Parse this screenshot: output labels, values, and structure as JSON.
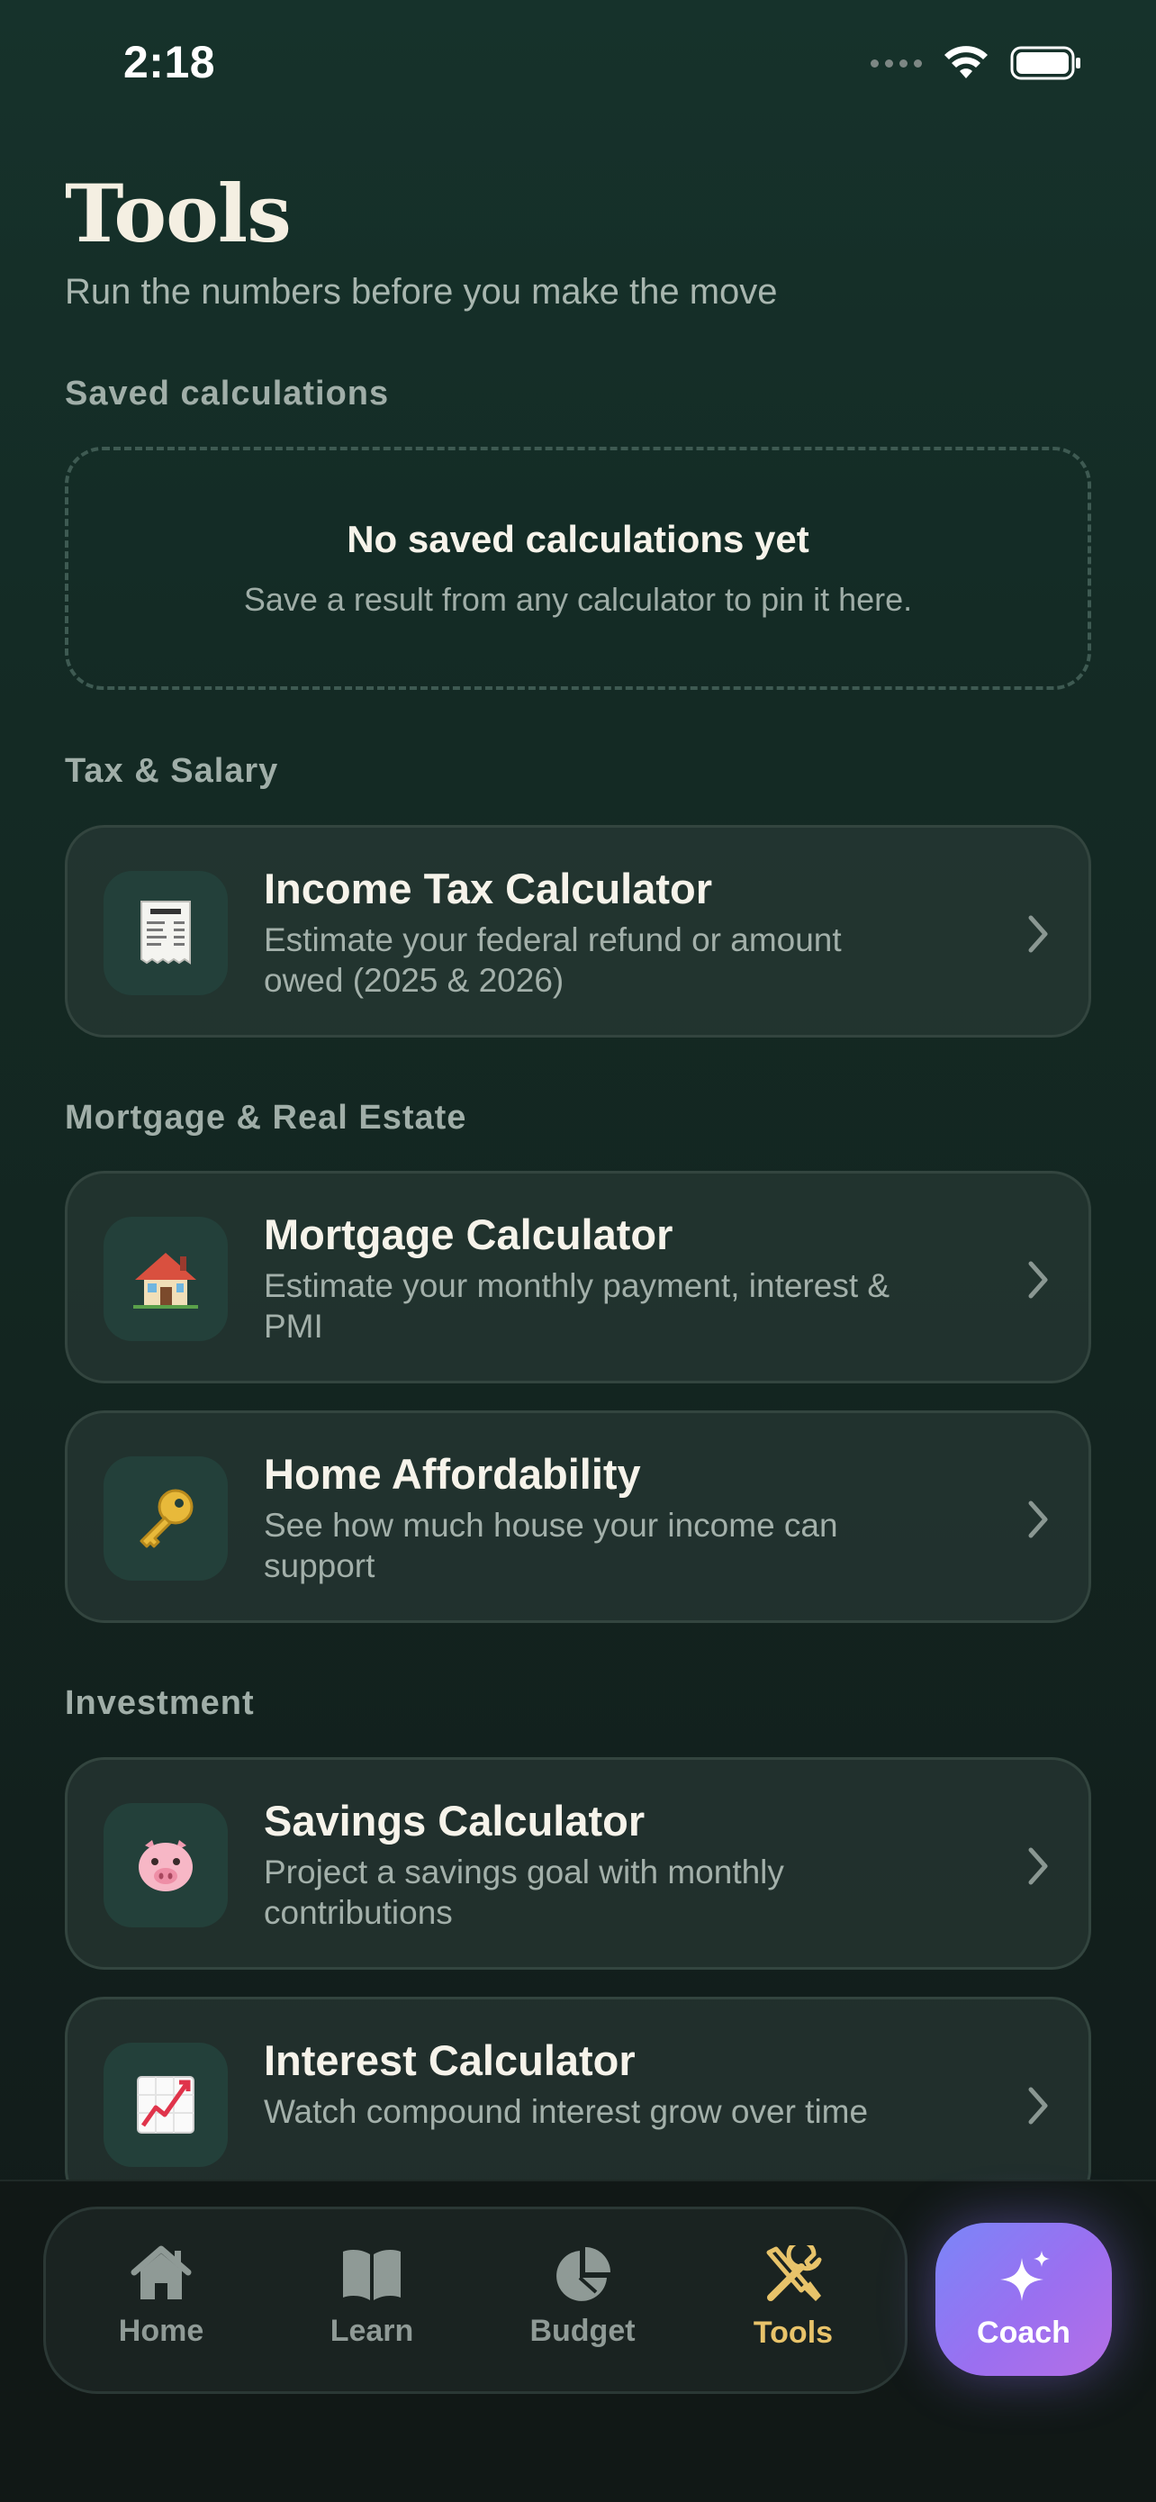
{
  "status_bar": {
    "time": "2:18"
  },
  "header": {
    "title": "Tools",
    "subtitle": "Run the numbers before you make the move"
  },
  "saved": {
    "label": "Saved calculations",
    "empty_title": "No saved calculations yet",
    "empty_desc": "Save a result from any calculator to pin it here."
  },
  "sections": {
    "tax": {
      "label": "Tax & Salary"
    },
    "mortgage": {
      "label": "Mortgage & Real Estate"
    },
    "investment": {
      "label": "Investment"
    }
  },
  "tools": [
    {
      "emoji": "🧾",
      "icon": "receipt-icon",
      "title": "Income Tax Calculator",
      "desc": "Estimate your federal refund or amount owed (2025 & 2026)"
    },
    {
      "emoji": "🏠",
      "icon": "house-icon",
      "title": "Mortgage Calculator",
      "desc": "Estimate your monthly payment, interest & PMI"
    },
    {
      "emoji": "🔑",
      "icon": "key-icon",
      "title": "Home Affordability",
      "desc": "See how much house your income can support"
    },
    {
      "emoji": "🐷",
      "icon": "piggy-icon",
      "title": "Savings Calculator",
      "desc": "Project a savings goal with monthly contributions"
    },
    {
      "emoji": "📈",
      "icon": "chart-increasing-icon",
      "title": "Interest Calculator",
      "desc": "Watch compound interest grow over time"
    }
  ],
  "tabbar": {
    "tabs": [
      {
        "label": "Home",
        "icon": "home-icon"
      },
      {
        "label": "Learn",
        "icon": "book-icon"
      },
      {
        "label": "Budget",
        "icon": "pie-chart-icon"
      },
      {
        "label": "Tools",
        "icon": "tools-icon",
        "active": true
      }
    ],
    "coach": {
      "label": "Coach",
      "icon": "sparkles-icon"
    }
  },
  "colors": {
    "accent": "#e8c36a",
    "coach_gradient_start": "#7a86f8",
    "coach_gradient_end": "#b56fe6",
    "background": "#142b25"
  }
}
